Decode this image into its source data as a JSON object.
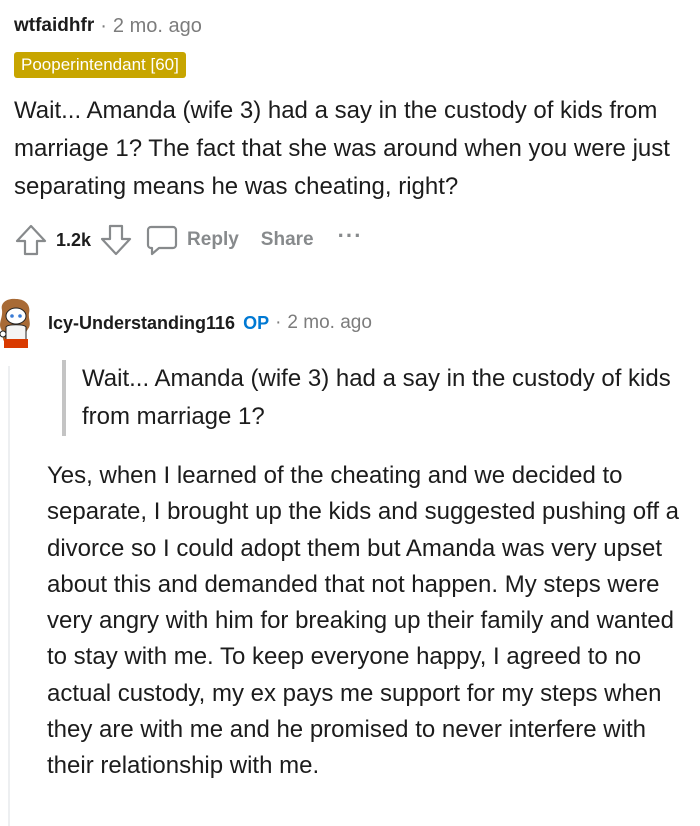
{
  "comment1": {
    "username": "wtfaidhfr",
    "separator": "·",
    "timestamp": "2 mo. ago",
    "flair": "Pooperintendant [60]",
    "body": "Wait... Amanda (wife 3) had a say in the custody of kids from marriage 1? The fact that she was around when you were just separating means he was cheating, right?",
    "upvote_icon": "upvote-arrow",
    "votes": "1.2k",
    "downvote_icon": "downvote-arrow",
    "reply_icon": "speech-bubble",
    "reply_label": "Reply",
    "share_label": "Share",
    "more_label": "···"
  },
  "comment2": {
    "avatar_icon": "snoo-avatar",
    "username": "Icy-Understanding116",
    "op_badge": "OP",
    "separator": "·",
    "timestamp": "2 mo. ago",
    "quote": "Wait... Amanda (wife 3) had a say in the custody of kids from marriage 1?",
    "body": "Yes, when I learned of the cheating and we decided to separate, I brought up the kids and suggested pushing off a divorce so I could adopt them but Amanda was very upset about this and demanded that not happen. My steps were very angry with him for breaking up their family and wanted to stay with me. To keep everyone happy, I agreed to no actual custody, my ex pays me support for my steps when they are with me and he promised to never interfere with their relationship with me."
  },
  "colors": {
    "flair_bg": "#c7a500",
    "op_blue": "#0079d3",
    "meta_gray": "#7c7c7c",
    "action_gray": "#878a8c"
  }
}
